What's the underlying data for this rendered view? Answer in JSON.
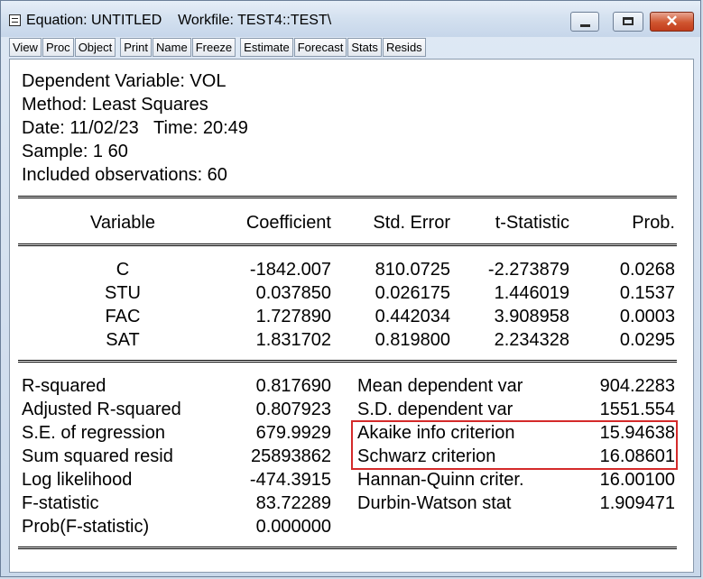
{
  "window": {
    "title": "Equation: UNTITLED    Workfile: TEST4::TEST\\",
    "controls": {
      "minimize": "minimize",
      "maximize": "maximize",
      "close": "✕"
    }
  },
  "toolbar": {
    "buttons": [
      "View",
      "Proc",
      "Object",
      "Print",
      "Name",
      "Freeze",
      "Estimate",
      "Forecast",
      "Stats",
      "Resids"
    ]
  },
  "header": {
    "dependent": "Dependent Variable: VOL",
    "method": "Method: Least Squares",
    "date": "Date: 11/02/23   Time: 20:49",
    "sample": "Sample: 1 60",
    "obs": "Included observations: 60"
  },
  "table": {
    "columns": [
      "Variable",
      "Coefficient",
      "Std. Error",
      "t-Statistic",
      "Prob."
    ],
    "rows": [
      [
        "C",
        "-1842.007",
        "810.0725",
        "-2.273879",
        "0.0268"
      ],
      [
        "STU",
        "0.037850",
        "0.026175",
        "1.446019",
        "0.1537"
      ],
      [
        "FAC",
        "1.727890",
        "0.442034",
        "3.908958",
        "0.0003"
      ],
      [
        "SAT",
        "1.831702",
        "0.819800",
        "2.234328",
        "0.0295"
      ]
    ]
  },
  "stats": {
    "left": [
      [
        "R-squared",
        "0.817690"
      ],
      [
        "Adjusted R-squared",
        "0.807923"
      ],
      [
        "S.E. of regression",
        "679.9929"
      ],
      [
        "Sum squared resid",
        "25893862"
      ],
      [
        "Log likelihood",
        "-474.3915"
      ],
      [
        "F-statistic",
        "83.72289"
      ],
      [
        "Prob(F-statistic)",
        "0.000000"
      ]
    ],
    "right": [
      [
        "Mean dependent var",
        "904.2283"
      ],
      [
        "S.D. dependent var",
        "1551.554"
      ],
      [
        "Akaike info criterion",
        "15.94638"
      ],
      [
        "Schwarz criterion",
        "16.08601"
      ],
      [
        "Hannan-Quinn criter.",
        "16.00100"
      ],
      [
        "Durbin-Watson stat",
        "1.909471"
      ]
    ]
  },
  "colors": {
    "highlight": "#d42a2a",
    "close_button": "#c84426",
    "window_frame": "#cfdbe9"
  },
  "icons": [
    "app-menu-icon",
    "minimize-icon",
    "maximize-icon",
    "close-icon"
  ]
}
